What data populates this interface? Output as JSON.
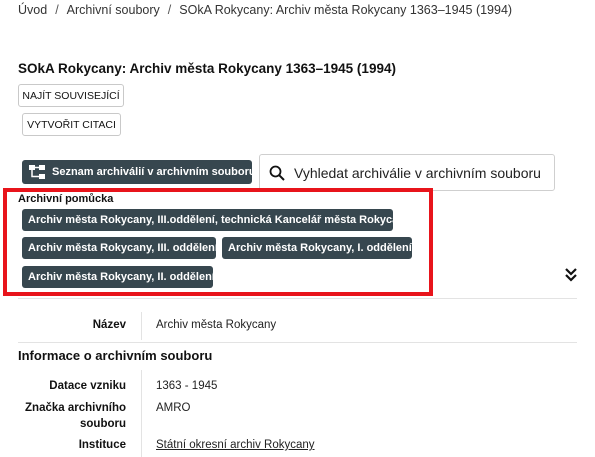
{
  "breadcrumb": {
    "items": [
      "Úvod",
      "Archivní soubory",
      "SOkA Rokycany: Archiv města Rokycany 1363–1945 (1994)"
    ],
    "separator": "/"
  },
  "page_title": "SOkA Rokycany: Archiv města Rokycany 1363–1945 (1994)",
  "actions": {
    "find_related": "NAJÍT SOUVISEJÍCÍ",
    "create_citation": "VYTVOŘIT CITACI"
  },
  "archive_list_button": {
    "label": "Seznam archiválií v archivním souboru",
    "icon": "tree-structure-icon"
  },
  "search_button": {
    "label": "Vyhledat archiválie v archivním souboru",
    "icon": "search-icon"
  },
  "finding_aid": {
    "label": "Archivní pomůcka",
    "chips": [
      "Archiv města Rokycany, III.oddělení, technická Kancelář města Rokycan",
      "Archiv města Rokycany, III. oddělení",
      "Archiv města Rokycany, I. oddělení",
      "Archiv města Rokycany, II. oddělení"
    ],
    "expand_icon": "double-chevron-down-icon"
  },
  "name_row": {
    "label": "Název",
    "value": "Archiv města Rokycany"
  },
  "info_section": {
    "heading": "Informace o archivním souboru",
    "rows": [
      {
        "label": "Datace vzniku",
        "value": "1363 - 1945"
      },
      {
        "label_line1": "Značka archivního",
        "label_line2": "souboru",
        "value": "AMRO"
      },
      {
        "label": "Instituce",
        "value": "Státní okresní archiv Rokycany"
      }
    ]
  },
  "colors": {
    "chip_bg": "#37474f",
    "highlight_frame": "#e8141b"
  }
}
